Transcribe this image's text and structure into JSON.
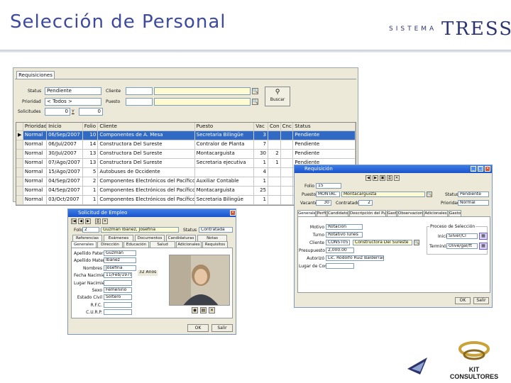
{
  "slide": {
    "title": "Selección de Personal",
    "brand_small": "SISTEMA",
    "brand_big": "TRESS",
    "footer_logo": "KIT CONSULTORES"
  },
  "main_window": {
    "tab": "Requisiciones",
    "filters": {
      "status_label": "Status",
      "status_value": "Pendiente",
      "prioridad_label": "Prioridad",
      "prioridad_value": "< Todos >",
      "solicitudes_label": "Solicitudes",
      "sol_from": "0",
      "sol_y": "Y",
      "sol_to": "0",
      "cliente_label": "Cliente",
      "puesto_label": "Puesto",
      "buscar_label": "Buscar"
    },
    "columns": [
      "Prioridad",
      "Inicio",
      "Folio",
      "Cliente",
      "Puesto",
      "Vac",
      "Con",
      "Cnc",
      "Status"
    ],
    "rows": [
      [
        "Normal",
        "06/Sep/2007",
        "10",
        "Componentes de A. Mesa",
        "Secretaria Bilingüe",
        "3",
        "",
        "",
        "Pendiente"
      ],
      [
        "Normal",
        "06/Jul/2007",
        "14",
        "Constructora Del Sureste",
        "Contralor de Planta",
        "7",
        "",
        "",
        "Pendiente"
      ],
      [
        "Normal",
        "30/Jul/2007",
        "13",
        "Constructora Del Sureste",
        "Montacarguista",
        "30",
        "2",
        "",
        "Pendiente"
      ],
      [
        "Normal",
        "07/Ago/2007",
        "13",
        "Constructora Del Sureste",
        "Secretaria ejecutiva",
        "1",
        "1",
        "",
        "Pendiente"
      ],
      [
        "Normal",
        "15/Ago/2007",
        "5",
        "Autobuses de Occidente",
        "",
        "4",
        "",
        "",
        "Pendiente"
      ],
      [
        "Normal",
        "04/Sep/2007",
        "2",
        "Componentes Electrónicos del Pacífico",
        "Auxiliar Contable",
        "1",
        "",
        "",
        "Pendiente"
      ],
      [
        "Normal",
        "04/Sep/2007",
        "1",
        "Componentes Electrónicos del Pacífico",
        "Montacarguista",
        "25",
        "",
        "",
        "Pendiente"
      ],
      [
        "Normal",
        "03/Oct/2007",
        "1",
        "Componentes Electrónicos del Pacífico",
        "Secretaria Bilingüe",
        "1",
        "",
        "",
        "Pendiente"
      ]
    ]
  },
  "solicitud_window": {
    "title": "Solicitud de Empleo",
    "folio_label": "Folio",
    "folio_value": "2",
    "name_value": "Guzmán Ibáñez, Josefina",
    "status_label": "Status",
    "status_value": "Contratada",
    "tabs_row1": [
      "Referencias",
      "Exámenes",
      "Documentos",
      "Candidaturas",
      "Notas"
    ],
    "tabs_row2": [
      "Generales",
      "Dirección",
      "Educación",
      "Salud",
      "Adicionales",
      "Requisitos"
    ],
    "fields": [
      {
        "label": "Apellido Paterno",
        "value": "Guzmán"
      },
      {
        "label": "Apellido Materno",
        "value": "Ibáñez"
      },
      {
        "label": "Nombres",
        "value": "Josefina"
      },
      {
        "label": "Fecha Nacimiento",
        "value": "11/Feb/1975"
      },
      {
        "label": "Lugar Nacimiento",
        "value": ""
      },
      {
        "label": "Sexo",
        "value": "Femenino"
      },
      {
        "label": "Estado Civil",
        "value": "Soltero"
      },
      {
        "label": "R.F.C.",
        "value": ""
      },
      {
        "label": "C.U.R.P.",
        "value": ""
      }
    ],
    "age_value": "32 Años",
    "ok_label": "OK",
    "exit_label": "Salir"
  },
  "requisicion_window": {
    "title": "Requisición",
    "folio_label": "Folio",
    "folio_value": "15",
    "puesto_label": "Puesto",
    "puesto_code": "MONTAC",
    "puesto_value": "Montacarguista",
    "status_label": "Status",
    "status_value": "Pendiente",
    "vacantes_label": "Vacantes",
    "vacantes_value": "30",
    "contratados_label": "Contratados",
    "contratados_value": "2",
    "prioridad_label": "Prioridad",
    "prioridad_value": "Normal",
    "tabs": [
      "Generales",
      "Perfil",
      "Candidatos",
      "Descripción del Puesto",
      "Gastos",
      "Observaciones",
      "Adicionales",
      "Gastos"
    ],
    "fields": [
      {
        "label": "Motivo",
        "value": "Rotación"
      },
      {
        "label": "Turno",
        "value": "Rotativo lunes"
      },
      {
        "label": "Cliente",
        "value": "CONST05",
        "extra": "Constructora Del Sureste"
      },
      {
        "label": "Presupuesto",
        "value": "2,000.00"
      },
      {
        "label": "Autorizó",
        "value": "Lic. Rodolfo Ruiz Balderrama"
      },
      {
        "label": "Lugar de Contacto",
        "value": ""
      }
    ],
    "proceso_title": "Proceso de Selección",
    "proceso": [
      {
        "label": "Inició",
        "value": "Silver/Cl"
      },
      {
        "label": "Terminó",
        "value": "Olive/gal/ft"
      }
    ],
    "ok_label": "OK",
    "exit_label": "Salir"
  }
}
